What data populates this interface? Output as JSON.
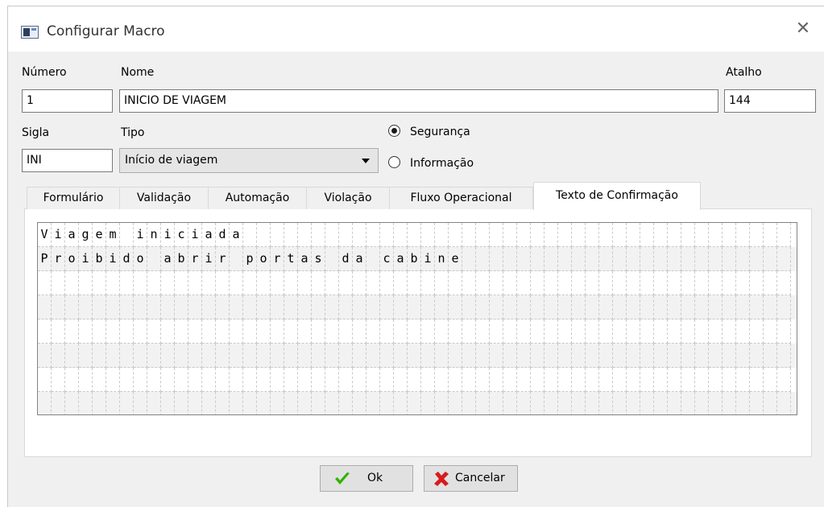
{
  "window": {
    "title": "Configurar Macro"
  },
  "fields": {
    "numero_label": "Número",
    "numero_value": "1",
    "nome_label": "Nome",
    "nome_value": "INICIO DE VIAGEM",
    "atalho_label": "Atalho",
    "atalho_value": "144",
    "sigla_label": "Sigla",
    "sigla_value": "INI",
    "tipo_label": "Tipo",
    "tipo_value": "Início de viagem"
  },
  "radios": [
    {
      "label": "Segurança",
      "checked": true
    },
    {
      "label": "Informação",
      "checked": false
    }
  ],
  "tabs": {
    "items": [
      "Formulário",
      "Validação",
      "Automação",
      "Violação",
      "Fluxo Operacional",
      "Texto de Confirmação"
    ],
    "active": "Texto de Confirmação"
  },
  "grid": {
    "columns": 55,
    "rows": 8,
    "lines": [
      "Viagem iniciada",
      "Proibido abrir portas da cabine"
    ]
  },
  "buttons": {
    "ok": "Ok",
    "cancel": "Cancelar"
  },
  "colors": {
    "ok_icon": "#2db300",
    "cancel_icon": "#d81b1b",
    "window_bg": "#f0f0f0"
  }
}
